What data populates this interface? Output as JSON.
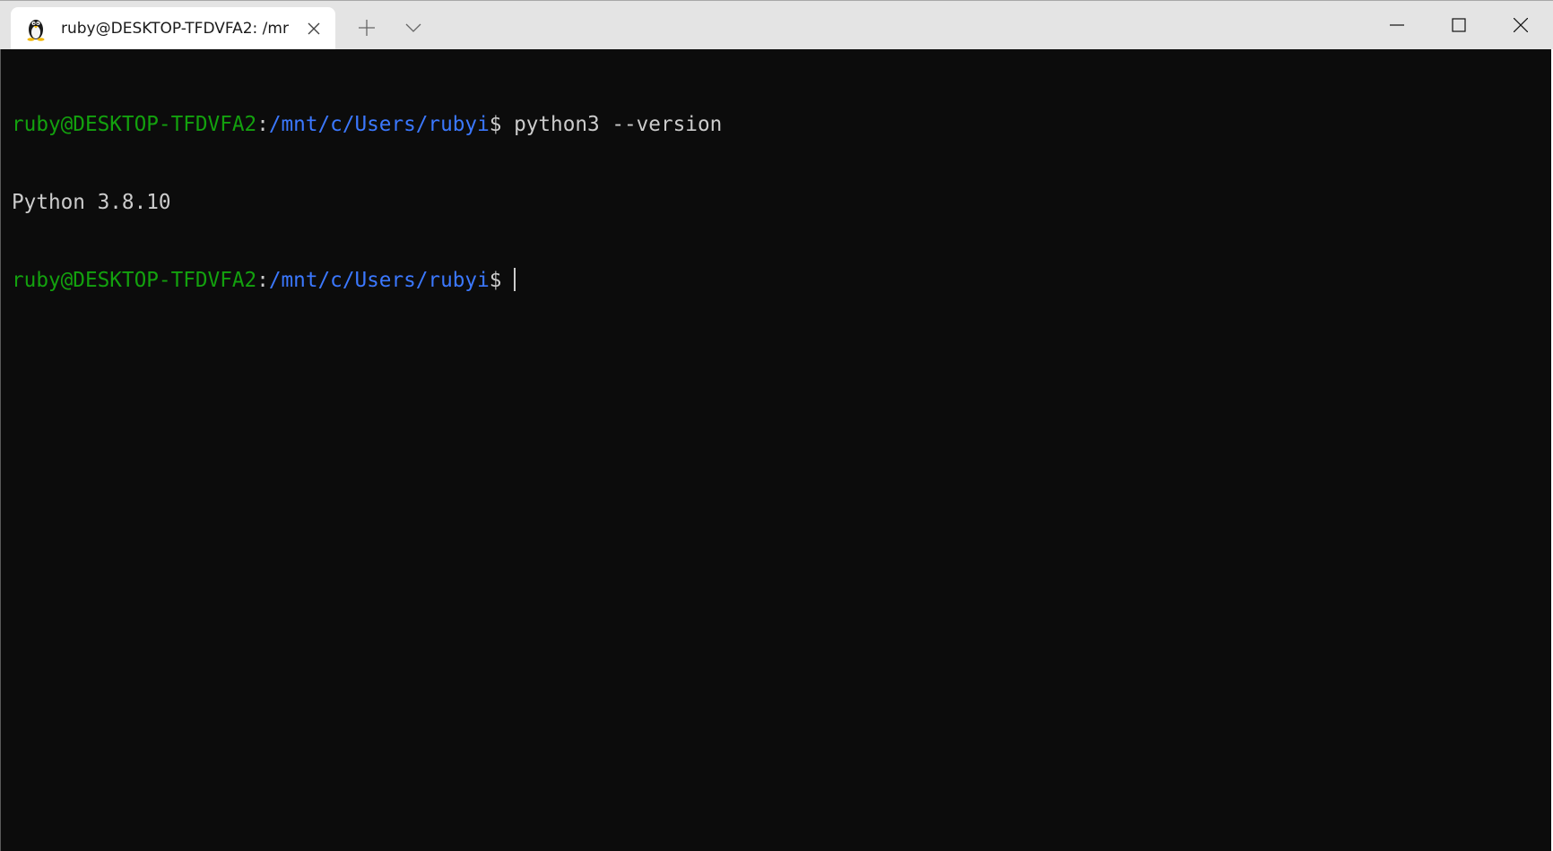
{
  "window": {
    "tab": {
      "title": "ruby@DESKTOP-TFDVFA2: /mr",
      "icon": "linux-tux-icon"
    },
    "buttons": {
      "close_tab_icon": "close-icon",
      "new_tab_icon": "plus-icon",
      "dropdown_icon": "chevron-down-icon",
      "minimize_icon": "minimize-icon",
      "maximize_icon": "maximize-icon",
      "close_window_icon": "close-icon"
    },
    "colors": {
      "user_host": "#13a10e",
      "path": "#3b78ff",
      "text": "#cccccc",
      "background": "#0c0c0c"
    }
  },
  "terminal": {
    "lines": [
      {
        "user_host": "ruby@DESKTOP-TFDVFA2",
        "separator": ":",
        "path": "/mnt/c/Users/rubyi",
        "prompt": "$ ",
        "command": "python3 --version"
      },
      {
        "output": "Python 3.8.10"
      },
      {
        "user_host": "ruby@DESKTOP-TFDVFA2",
        "separator": ":",
        "path": "/mnt/c/Users/rubyi",
        "prompt": "$ ",
        "command": ""
      }
    ]
  }
}
